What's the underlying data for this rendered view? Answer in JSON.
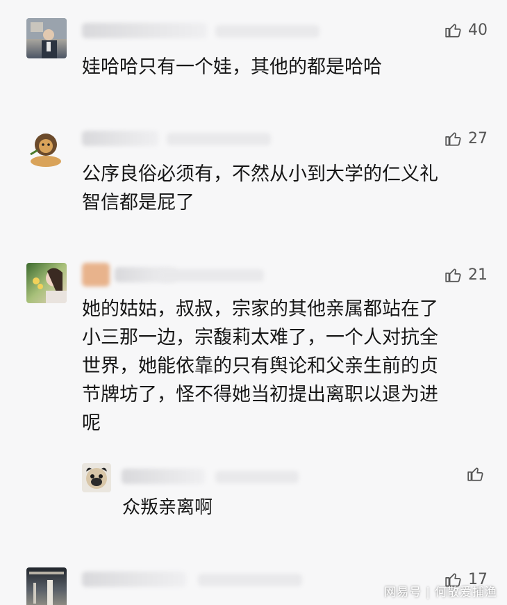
{
  "comments": [
    {
      "likes": "40",
      "text": "娃哈哈只有一个娃，其他的都是哈哈"
    },
    {
      "likes": "27",
      "text": "公序良俗必须有，不然从小到大学的仁义礼\n智信都是屁了"
    },
    {
      "likes": "21",
      "text": "她的姑姑，叔叔，宗家的其他亲属都站在了\n小三那一边，宗馥莉太难了，一个人对抗全\n世界，她能依靠的只有舆论和父亲生前的贞\n节牌坊了，怪不得她当初提出离职以退为进\n呢",
      "reply": {
        "likes": "",
        "text": "众叛亲离啊"
      }
    },
    {
      "likes": "17"
    }
  ],
  "watermark": {
    "source": "网易号",
    "separator": "|",
    "author": "何散爱捕渔"
  },
  "icons": {
    "like": "thumbs-up-icon"
  }
}
